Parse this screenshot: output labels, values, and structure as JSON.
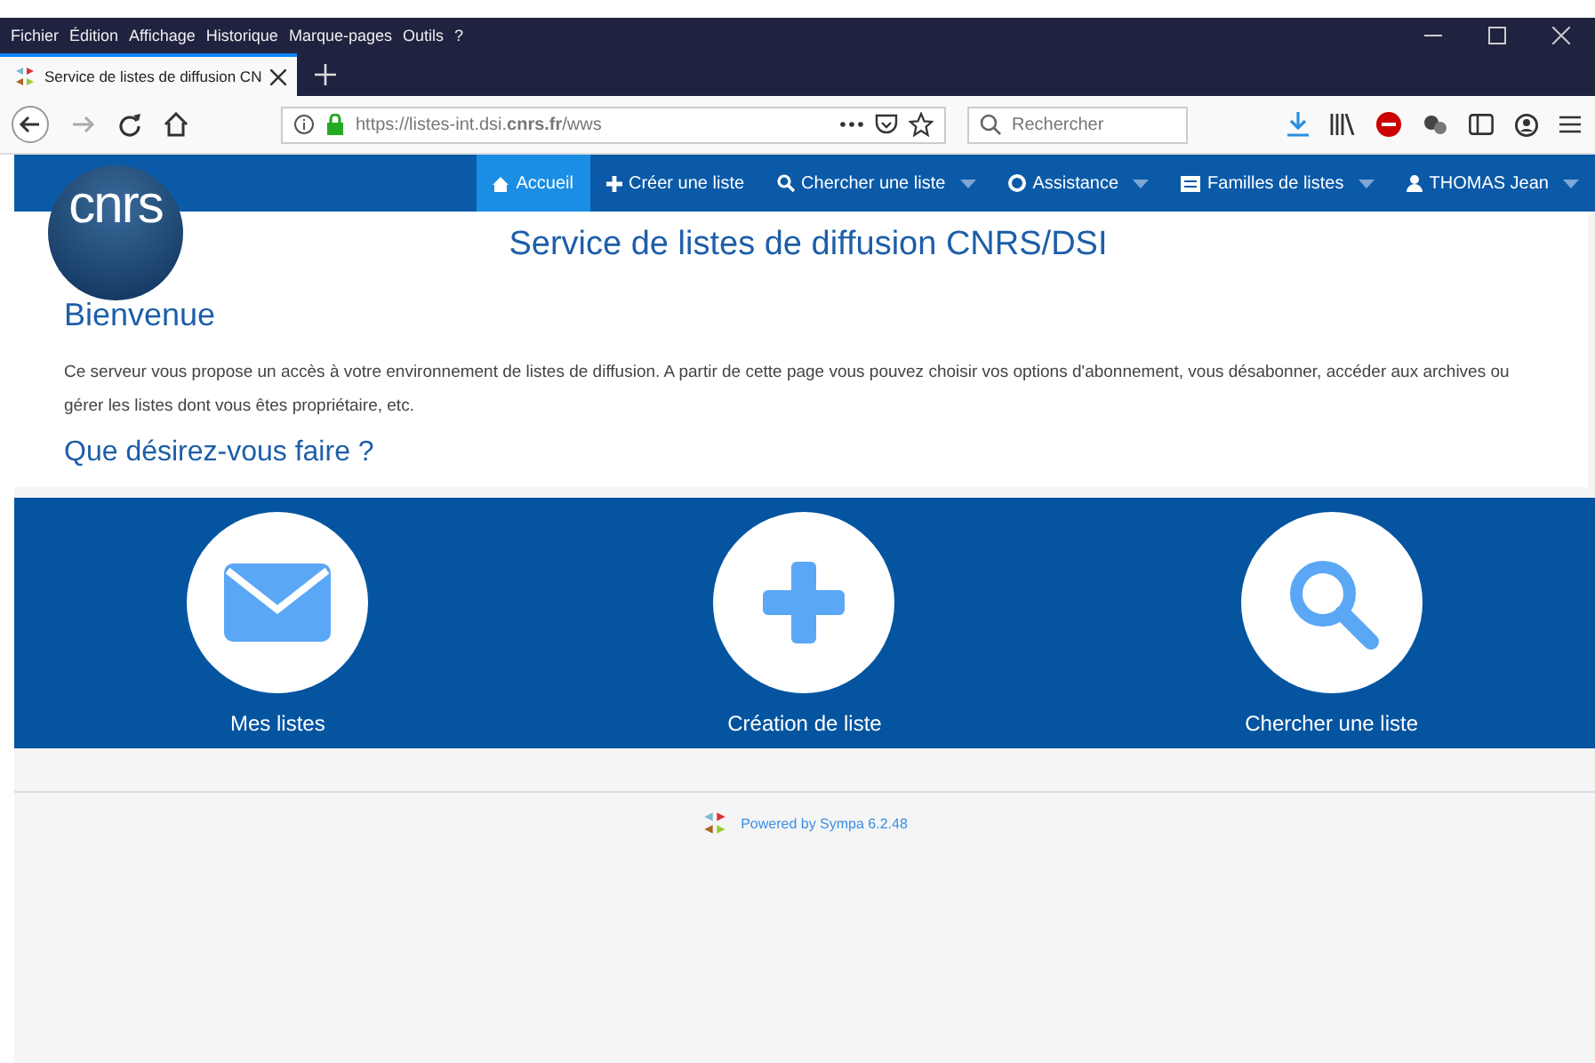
{
  "menu_bar": [
    "Fichier",
    "Édition",
    "Affichage",
    "Historique",
    "Marque-pages",
    "Outils",
    "?"
  ],
  "tabs": [
    {
      "label": "Service de listes de diffusion CN",
      "selected": true
    }
  ],
  "address_bar": {
    "url": "https://listes-int.dsi.**cnrs.fr**/wws"
  },
  "search": {
    "placeholder": "Rechercher"
  },
  "site_nav": {
    "logo": "cnrs",
    "items": [
      {
        "label": "Accueil",
        "kind": "home",
        "dropdown": false,
        "selected": true
      },
      {
        "label": "Créer une liste",
        "kind": "create",
        "dropdown": false,
        "selected": false
      },
      {
        "label": "Chercher une liste",
        "kind": "search",
        "dropdown": true,
        "selected": false
      },
      {
        "label": "Assistance",
        "kind": "help",
        "dropdown": true,
        "selected": false
      },
      {
        "label": "Familles de listes",
        "kind": "families",
        "dropdown": true,
        "selected": false
      },
      {
        "label": "THOMAS Jean",
        "kind": "user",
        "dropdown": true,
        "selected": false
      }
    ]
  },
  "header": {
    "title": "Service de listes de diffusion CNRS/DSI"
  },
  "welcome": {
    "heading": "Bienvenue",
    "text": "Ce serveur vous propose un accès à votre environnement de listes de diffusion. A partir de cette page vous pouvez choisir vos options d'abonnement, vous désabonner, accéder aux archives ou gérer les listes dont vous êtes propriétaire, etc.",
    "question": "Que désirez-vous faire ?"
  },
  "actions": [
    {
      "label": "Mes listes",
      "kind": "lists"
    },
    {
      "label": "Création de liste",
      "kind": "create"
    },
    {
      "label": "Chercher une liste",
      "kind": "search"
    }
  ],
  "footer": {
    "text": "Powered by Sympa 6.2.48"
  }
}
